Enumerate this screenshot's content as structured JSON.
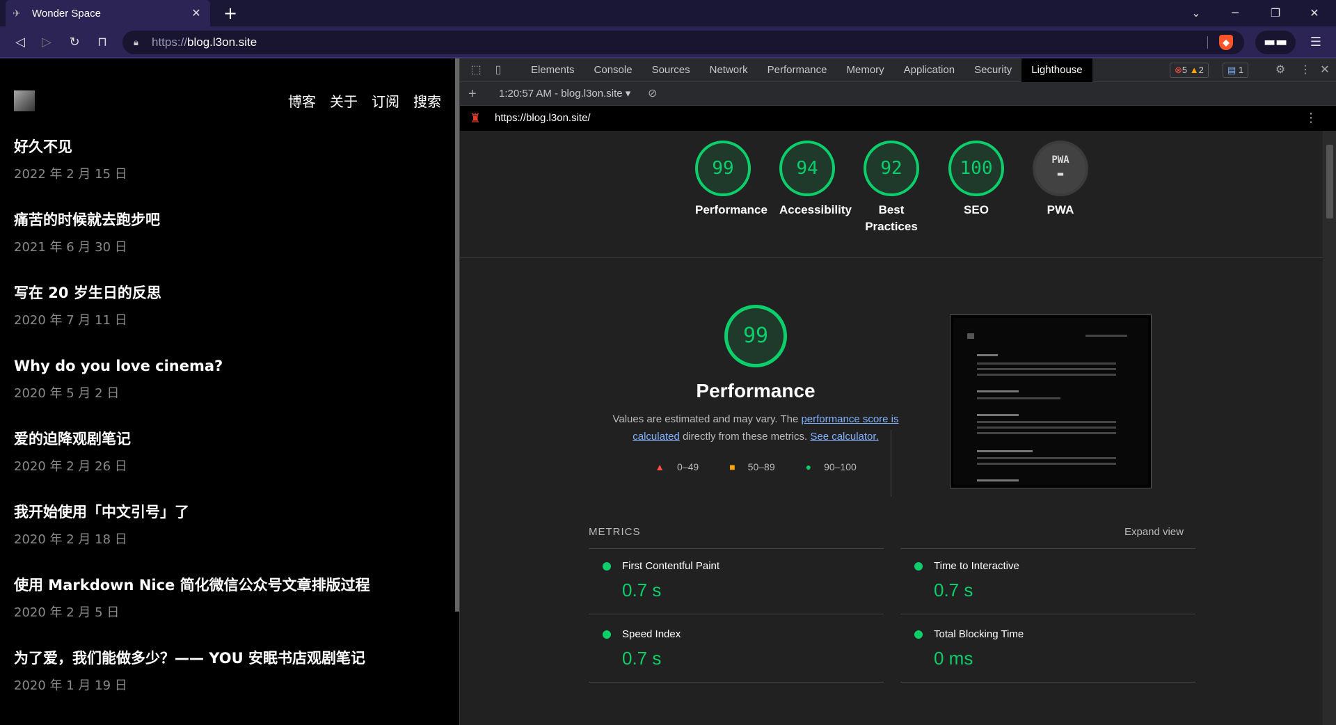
{
  "window": {
    "tab_title": "Wonder Space",
    "tab_close": "✕",
    "new_tab": "+",
    "controls": [
      "⌄",
      "─",
      "❐",
      "✕"
    ]
  },
  "addressbar": {
    "url_scheme": "https://",
    "url_host": "blog.l3on.site"
  },
  "blog": {
    "nav": [
      "博客",
      "关于",
      "订阅",
      "搜索"
    ],
    "posts": [
      {
        "title": "好久不见",
        "date": "2022 年 2 月 15 日"
      },
      {
        "title": "痛苦的时候就去跑步吧",
        "date": "2021 年 6 月 30 日"
      },
      {
        "title": "写在 20 岁生日的反思",
        "date": "2020 年 7 月 11 日"
      },
      {
        "title": "Why do you love cinema?",
        "date": "2020 年 5 月 2 日"
      },
      {
        "title": "爱的迫降观剧笔记",
        "date": "2020 年 2 月 26 日"
      },
      {
        "title": "我开始使用「中文引号」了",
        "date": "2020 年 2 月 18 日"
      },
      {
        "title": "使用 Markdown Nice 简化微信公众号文章排版过程",
        "date": "2020 年 2 月 5 日"
      },
      {
        "title": "为了爱，我们能做多少？—— YOU 安眠书店观剧笔记",
        "date": "2020 年 1 月 19 日"
      }
    ]
  },
  "devtools": {
    "tabs": [
      "Elements",
      "Console",
      "Sources",
      "Network",
      "Performance",
      "Memory",
      "Application",
      "Security",
      "Lighthouse"
    ],
    "active_tab": "Lighthouse",
    "errors": "5",
    "warnings": "2",
    "messages": "1",
    "run_label": "1:20:57 AM - blog.l3on.site ▾",
    "report_url": "https://blog.l3on.site/"
  },
  "lighthouse": {
    "scores": [
      {
        "label": "Performance",
        "value": "99"
      },
      {
        "label": "Accessibility",
        "value": "94"
      },
      {
        "label": "Best\nPractices",
        "value": "92"
      },
      {
        "label": "SEO",
        "value": "100"
      },
      {
        "label": "PWA",
        "value": "PWA"
      }
    ],
    "performance": {
      "score": "99",
      "title": "Performance",
      "desc_1": "Values are estimated and may vary. The ",
      "link_1": "performance score is calculated",
      "desc_2": " directly from these metrics. ",
      "link_2": "See calculator."
    },
    "legend": [
      "0–49",
      "50–89",
      "90–100"
    ],
    "metrics_title": "METRICS",
    "expand_view": "Expand view",
    "metrics": [
      {
        "name": "First Contentful Paint",
        "value": "0.7 s"
      },
      {
        "name": "Time to Interactive",
        "value": "0.7 s"
      },
      {
        "name": "Speed Index",
        "value": "0.7 s"
      },
      {
        "name": "Total Blocking Time",
        "value": "0 ms"
      }
    ],
    "colors": {
      "pass": "#0cce6b",
      "average": "#ffa400",
      "fail": "#ff4e42"
    }
  }
}
